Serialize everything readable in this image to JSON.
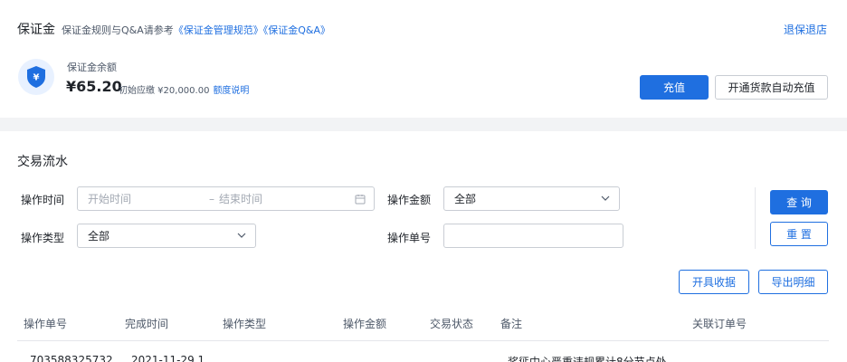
{
  "header": {
    "title": "保证金",
    "rules_prefix": "保证金规则与Q&A请参考",
    "rules_link_1": "《保证金管理规范》",
    "rules_link_2": "《保证金Q&A》",
    "exit_link": "退保退店"
  },
  "balance": {
    "label": "保证金余额",
    "amount": "¥65.20",
    "initial_text": "初始应缴 ¥20,000.00",
    "quota_link": "额度说明",
    "icon_symbol": "¥",
    "recharge_button": "充值",
    "auto_recharge_button": "开通货款自动充值"
  },
  "transactions": {
    "title": "交易流水",
    "filters": {
      "time_label": "操作时间",
      "start_placeholder": "开始时间",
      "separator": "–",
      "end_placeholder": "结束时间",
      "amount_label": "操作金额",
      "amount_value": "全部",
      "type_label": "操作类型",
      "type_value": "全部",
      "order_label": "操作单号",
      "order_value": ""
    },
    "query_button": "查 询",
    "reset_button": "重 置",
    "receipt_button": "开具收据",
    "export_button": "导出明细",
    "columns": [
      "操作单号",
      "完成时间",
      "操作类型",
      "操作金额",
      "交易状态",
      "备注",
      "关联订单号"
    ],
    "rows": [
      {
        "order_no": "703588325732",
        "time": "2021-11-29 1",
        "remark": "奖惩中心严重违规累计8分节点处"
      }
    ]
  },
  "colors": {
    "accent": "#1f6fe0",
    "background": "#f2f3f5"
  }
}
